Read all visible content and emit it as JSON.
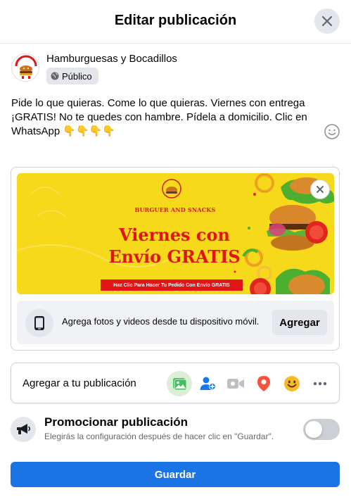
{
  "header": {
    "title": "Editar publicación",
    "close_icon": "close-icon"
  },
  "author": {
    "name": "Hamburguesas y Bocadillos",
    "privacy": "Público",
    "avatar_icon": "burger-logo-icon"
  },
  "post": {
    "lines": [
      "Pide lo que quieras. Come lo que quieras. Viernes con entrega",
      "¡GRATIS! No te quedes con hambre. Pídela a domicilio. Clic en",
      "WhatsApp 👇👇👇👇"
    ]
  },
  "media": {
    "banner": {
      "brand": "BURGUER AND SNACKS",
      "line1": "Viernes con",
      "line2": "Envío GRATIS",
      "cta": "Haz Clic Para Hacer Tu Pedido Con Envío GRATIS",
      "background_color": "#f5d91a",
      "text_color": "#e01515"
    },
    "mobile_text": "Agrega fotos y videos desde tu dispositivo móvil.",
    "add_label": "Agregar"
  },
  "add_to_post": {
    "label": "Agregar a tu publicación",
    "tools": [
      "photo-video-icon",
      "tag-people-icon",
      "live-video-icon",
      "check-in-icon",
      "feeling-icon",
      "more-icon"
    ]
  },
  "promote": {
    "title": "Promocionar publicación",
    "subtitle": "Elegirás la configuración después de hacer clic en \"Guardar\".",
    "enabled": false
  },
  "footer": {
    "save_label": "Guardar",
    "accent_color": "#1b74e4"
  }
}
